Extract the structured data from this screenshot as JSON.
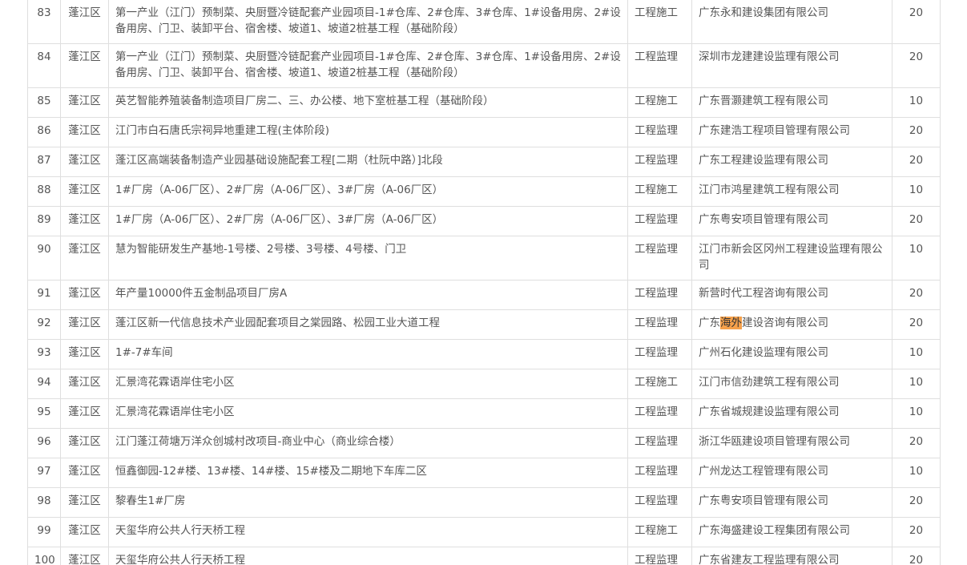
{
  "table": {
    "rows": [
      {
        "idx": "83",
        "district": "蓬江区",
        "project": "第一产业（江门）预制菜、央厨暨冷链配套产业园项目-1#仓库、2#仓库、3#仓库、1#设备用房、2#设备用房、门卫、装卸平台、宿舍楼、坡道1、坡道2桩基工程（基础阶段）",
        "type": "工程施工",
        "company": "广东永和建设集团有限公司",
        "score": "20"
      },
      {
        "idx": "84",
        "district": "蓬江区",
        "project": "第一产业（江门）预制菜、央厨暨冷链配套产业园项目-1#仓库、2#仓库、3#仓库、1#设备用房、2#设备用房、门卫、装卸平台、宿舍楼、坡道1、坡道2桩基工程（基础阶段）",
        "type": "工程监理",
        "company": "深圳市龙建建设监理有限公司",
        "score": "20"
      },
      {
        "idx": "85",
        "district": "蓬江区",
        "project": "英艺智能养殖装备制造项目厂房二、三、办公楼、地下室桩基工程（基础阶段）",
        "type": "工程施工",
        "company": "广东晋灏建筑工程有限公司",
        "score": "10"
      },
      {
        "idx": "86",
        "district": "蓬江区",
        "project": "江门市白石唐氏宗祠异地重建工程(主体阶段)",
        "type": "工程监理",
        "company": "广东建浩工程项目管理有限公司",
        "score": "20"
      },
      {
        "idx": "87",
        "district": "蓬江区",
        "project": "蓬江区高端装备制造产业园基础设施配套工程[二期（杜阮中路）]北段",
        "type": "工程监理",
        "company": "广东工程建设监理有限公司",
        "score": "20"
      },
      {
        "idx": "88",
        "district": "蓬江区",
        "project": "1#厂房（A-06厂区）、2#厂房（A-06厂区）、3#厂房（A-06厂区）",
        "type": "工程施工",
        "company": "江门市鸿星建筑工程有限公司",
        "score": "10"
      },
      {
        "idx": "89",
        "district": "蓬江区",
        "project": "1#厂房（A-06厂区）、2#厂房（A-06厂区）、3#厂房（A-06厂区）",
        "type": "工程监理",
        "company": "广东粤安项目管理有限公司",
        "score": "20"
      },
      {
        "idx": "90",
        "district": "蓬江区",
        "project": "慧为智能研发生产基地-1号楼、2号楼、3号楼、4号楼、门卫",
        "type": "工程监理",
        "company": "江门市新会区冈州工程建设监理有限公司",
        "score": "10"
      },
      {
        "idx": "91",
        "district": "蓬江区",
        "project": "年产量10000件五金制品项目厂房A",
        "type": "工程监理",
        "company": "新营时代工程咨询有限公司",
        "score": "20"
      },
      {
        "idx": "92",
        "district": "蓬江区",
        "project": "蓬江区新一代信息技术产业园配套项目之棠园路、松园工业大道工程",
        "type": "工程监理",
        "company_pre": "广东",
        "company_hl": "海外",
        "company_post": "建设咨询有限公司",
        "score": "20"
      },
      {
        "idx": "93",
        "district": "蓬江区",
        "project": "1#-7#车间",
        "type": "工程监理",
        "company": "广州石化建设监理有限公司",
        "score": "10"
      },
      {
        "idx": "94",
        "district": "蓬江区",
        "project": "汇景湾花霖语岸住宅小区",
        "type": "工程施工",
        "company": "江门市信劲建筑工程有限公司",
        "score": "10"
      },
      {
        "idx": "95",
        "district": "蓬江区",
        "project": "汇景湾花霖语岸住宅小区",
        "type": "工程监理",
        "company": "广东省城规建设监理有限公司",
        "score": "10"
      },
      {
        "idx": "96",
        "district": "蓬江区",
        "project": "江门蓬江荷塘万洋众创城村改项目-商业中心（商业综合楼）",
        "type": "工程监理",
        "company": "浙江华瓯建设项目管理有限公司",
        "score": "20"
      },
      {
        "idx": "97",
        "district": "蓬江区",
        "project": "恒鑫御园-12#楼、13#楼、14#楼、15#楼及二期地下车库二区",
        "type": "工程监理",
        "company": "广州龙达工程管理有限公司",
        "score": "10"
      },
      {
        "idx": "98",
        "district": "蓬江区",
        "project": "黎春生1#厂房",
        "type": "工程监理",
        "company": "广东粤安项目管理有限公司",
        "score": "20"
      },
      {
        "idx": "99",
        "district": "蓬江区",
        "project": "天玺华府公共人行天桥工程",
        "type": "工程施工",
        "company": "广东海盛建设工程集团有限公司",
        "score": "20"
      },
      {
        "idx": "100",
        "district": "蓬江区",
        "project": "天玺华府公共人行天桥工程",
        "type": "工程监理",
        "company": "广东省建友工程监理有限公司",
        "score": "20"
      }
    ]
  },
  "colors": {
    "highlight": "#f5a04a",
    "border": "#dfdfdf",
    "text": "#555555"
  }
}
